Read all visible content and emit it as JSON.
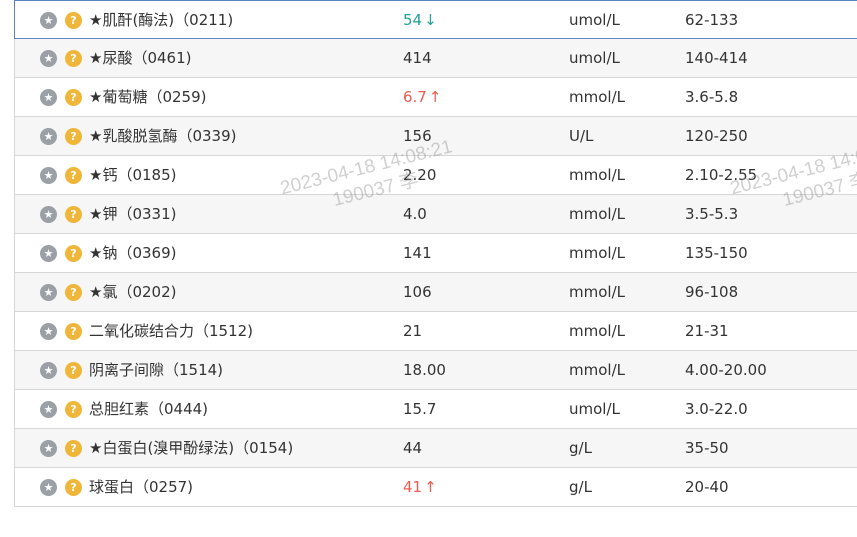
{
  "rows": [
    {
      "name": "★肌酐(酶法)（0211)",
      "value": "54",
      "flag": "low",
      "arrow": "↓",
      "unit": "umol/L",
      "ref": "62-133",
      "selected": true
    },
    {
      "name": "★尿酸（0461)",
      "value": "414",
      "flag": "",
      "arrow": "",
      "unit": "umol/L",
      "ref": "140-414"
    },
    {
      "name": "★葡萄糖（0259)",
      "value": "6.7",
      "flag": "high",
      "arrow": "↑",
      "unit": "mmol/L",
      "ref": "3.6-5.8"
    },
    {
      "name": "★乳酸脱氢酶（0339)",
      "value": "156",
      "flag": "",
      "arrow": "",
      "unit": "U/L",
      "ref": "120-250"
    },
    {
      "name": "★钙（0185)",
      "value": "2.20",
      "flag": "",
      "arrow": "",
      "unit": "mmol/L",
      "ref": "2.10-2.55"
    },
    {
      "name": "★钾（0331)",
      "value": "4.0",
      "flag": "",
      "arrow": "",
      "unit": "mmol/L",
      "ref": "3.5-5.3"
    },
    {
      "name": "★钠（0369)",
      "value": "141",
      "flag": "",
      "arrow": "",
      "unit": "mmol/L",
      "ref": "135-150"
    },
    {
      "name": "★氯（0202)",
      "value": "106",
      "flag": "",
      "arrow": "",
      "unit": "mmol/L",
      "ref": "96-108"
    },
    {
      "name": "二氧化碳结合力（1512)",
      "value": "21",
      "flag": "",
      "arrow": "",
      "unit": "mmol/L",
      "ref": "21-31"
    },
    {
      "name": "阴离子间隙（1514)",
      "value": "18.00",
      "flag": "",
      "arrow": "",
      "unit": "mmol/L",
      "ref": "4.00-20.00"
    },
    {
      "name": "总胆红素（0444)",
      "value": "15.7",
      "flag": "",
      "arrow": "",
      "unit": "umol/L",
      "ref": "3.0-22.0"
    },
    {
      "name": "★白蛋白(溴甲酚绿法)（0154)",
      "value": "44",
      "flag": "",
      "arrow": "",
      "unit": "g/L",
      "ref": "35-50"
    },
    {
      "name": "球蛋白（0257)",
      "value": "41",
      "flag": "high",
      "arrow": "↑",
      "unit": "g/L",
      "ref": "20-40"
    }
  ],
  "watermark": {
    "line1": "2023-04-18 14:08:21",
    "line2": "190037 李"
  },
  "icons": {
    "star": "star-icon",
    "help": "help-icon"
  }
}
